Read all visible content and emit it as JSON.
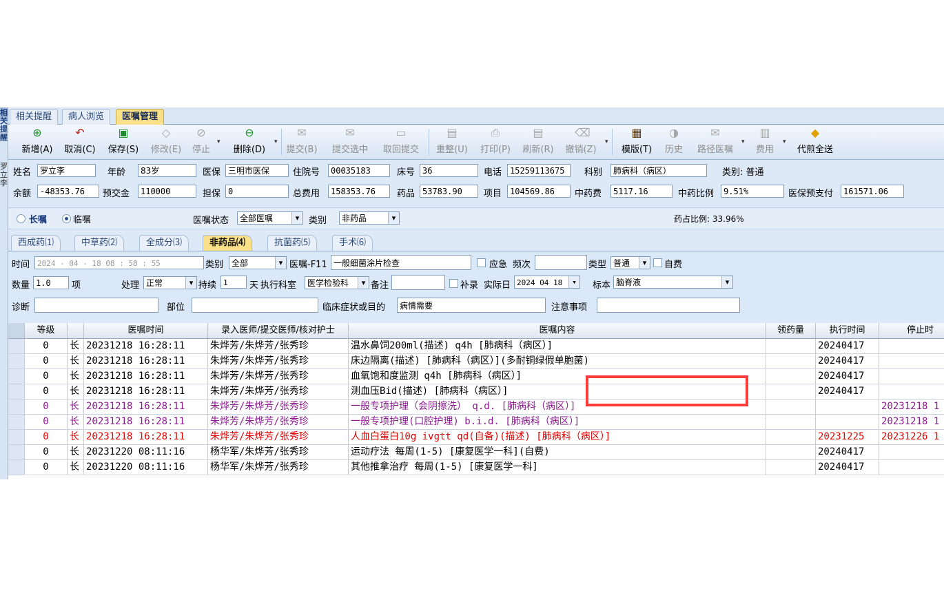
{
  "side": {
    "label1": "相关提醒",
    "label2": "罗立李"
  },
  "top_tabs": [
    "相关提醒",
    "病人浏览",
    "医嘱管理"
  ],
  "toolbar": [
    {
      "label": "新增(A)",
      "icon": "⊕"
    },
    {
      "label": "取消(C)",
      "icon": "↶"
    },
    {
      "label": "保存(S)",
      "icon": "▣"
    },
    {
      "label": "修改(E)",
      "icon": "◇"
    },
    {
      "label": "停止",
      "icon": "⊘"
    },
    {
      "label": "删除(D)",
      "icon": "⊖"
    },
    {
      "label": "提交(B)",
      "icon": "✉"
    },
    {
      "label": "提交选中",
      "icon": "✉"
    },
    {
      "label": "取回提交",
      "icon": "▭"
    },
    {
      "label": "重整(U)",
      "icon": "▤"
    },
    {
      "label": "打印(P)",
      "icon": "⎙"
    },
    {
      "label": "刷新(R)",
      "icon": "▤"
    },
    {
      "label": "撤销(Z)",
      "icon": "⌫"
    },
    {
      "label": "模版(T)",
      "icon": "▦"
    },
    {
      "label": "历史",
      "icon": "◑"
    },
    {
      "label": "路径医嘱",
      "icon": "✉"
    },
    {
      "label": "费用",
      "icon": "▥"
    },
    {
      "label": "代煎全送",
      "icon": "◆"
    }
  ],
  "patient": {
    "name_label": "姓名",
    "name": "罗立李",
    "age_label": "年龄",
    "age": "83岁",
    "insurance_label": "医保",
    "insurance": "三明市医保",
    "admission_label": "住院号",
    "admission": "00035183",
    "bed_label": "床号",
    "bed": "36",
    "phone_label": "电话",
    "phone": "15259113675",
    "dept_label": "科别",
    "dept": "肺病科（病区）",
    "category_text": "类别: 普通",
    "balance_label": "余额",
    "balance": "-48353.76",
    "prepay_label": "预交金",
    "prepay": "110000",
    "guarantee_label": "担保",
    "guarantee": "0",
    "total_label": "总费用",
    "total": "158353.76",
    "drug_label": "药品",
    "drug": "53783.90",
    "item_label": "项目",
    "item": "104569.86",
    "tcm_label": "中药费",
    "tcm": "5117.16",
    "tcm_ratio_label": "中药比例",
    "tcm_ratio": "9.51%",
    "ins_prepay_label": "医保预支付",
    "ins_prepay": "161571.06"
  },
  "order_filter": {
    "long_label": "长嘱",
    "temp_label": "临嘱",
    "status_label": "医嘱状态",
    "status": "全部医嘱",
    "type_label": "类别",
    "type": "非药品",
    "ratio_text": "药占比例: 33.96%"
  },
  "sub_tabs": [
    "西成药⑴",
    "中草药⑵",
    "全成分⑶",
    "非药品⑷",
    "抗菌药⑸",
    "手术⑹"
  ],
  "form": {
    "time_label": "时间",
    "time": "2024 - 04 - 18   08 : 58 : 55",
    "cat_label": "类别",
    "cat": "全部",
    "order_label": "医嘱-F11",
    "order": "一般细菌涂片检查",
    "urgent_label": "应急",
    "freq_label": "频次",
    "freq": "",
    "kind_label": "类型",
    "kind": "普通",
    "selfpay_label": "自费",
    "qty_label": "数量",
    "qty": "1.0",
    "unit": "项",
    "proc_label": "处理",
    "proc": "正常",
    "dur_label": "持续",
    "dur": "1",
    "day_label": "天",
    "exec_dept_label": "执行科室",
    "exec_dept": "医学检验科",
    "note_label": "备注",
    "note": "",
    "supp_label": "补录",
    "actual_label": "实际日",
    "actual": "2024 04 18",
    "specimen_label": "标本",
    "specimen": "脑脊液",
    "diag_label": "诊断",
    "diag": "",
    "site_label": "部位",
    "site": "",
    "purpose_label": "临床症状或目的",
    "purpose": "病情需要",
    "attention_label": "注意事项",
    "attention": ""
  },
  "grid": {
    "headers": [
      "等级",
      "",
      "医嘱时间",
      "录入医师/提交医师/核对护士",
      "医嘱内容",
      "领药量",
      "执行时间",
      "停止时"
    ],
    "rows": [
      {
        "level": "0",
        "type": "长",
        "time": "20231218 16:28:11",
        "doctors": "朱烨芳/朱烨芳/张秀珍",
        "content": "温水鼻饲200ml(描述)  q4h  [肺病科（病区）]",
        "qty": "",
        "exec": "20240417",
        "stop": "",
        "style": "normal"
      },
      {
        "level": "0",
        "type": "长",
        "time": "20231218 16:28:11",
        "doctors": "朱烨芳/朱烨芳/张秀珍",
        "content": "床边隔离(描述)     [肺病科（病区）](多耐铜绿假单胞菌)",
        "qty": "",
        "exec": "20240417",
        "stop": "",
        "style": "normal"
      },
      {
        "level": "0",
        "type": "长",
        "time": "20231218 16:28:11",
        "doctors": "朱烨芳/朱烨芳/张秀珍",
        "content": "血氧饱和度监测  q4h  [肺病科（病区）]",
        "qty": "",
        "exec": "20240417",
        "stop": "",
        "style": "normal"
      },
      {
        "level": "0",
        "type": "长",
        "time": "20231218 16:28:11",
        "doctors": "朱烨芳/朱烨芳/张秀珍",
        "content": "测血压Bid(描述)     [肺病科（病区）]",
        "qty": "",
        "exec": "20240417",
        "stop": "",
        "style": "normal"
      },
      {
        "level": "0",
        "type": "长",
        "time": "20231218 16:28:11",
        "doctors": "朱烨芳/朱烨芳/张秀珍",
        "content": "一般专项护理（会阴擦洗）  q.d.  [肺病科（病区）]",
        "qty": "",
        "exec": "",
        "stop": "20231218 1",
        "style": "purple"
      },
      {
        "level": "0",
        "type": "长",
        "time": "20231218 16:28:11",
        "doctors": "朱烨芳/朱烨芳/张秀珍",
        "content": "一般专项护理(口腔护理)  b.i.d.  [肺病科（病区）]",
        "qty": "",
        "exec": "",
        "stop": "20231218 1",
        "style": "purple"
      },
      {
        "level": "0",
        "type": "长",
        "time": "20231218 16:28:11",
        "doctors": "朱烨芳/朱烨芳/张秀珍",
        "content": "人血白蛋白10g ivgtt qd(自备)(描述)     [肺病科（病区）]",
        "qty": "",
        "exec": "20231225",
        "stop": "20231226 1",
        "style": "red"
      },
      {
        "level": "0",
        "type": "长",
        "time": "20231220 08:11:16",
        "doctors": "杨华军/朱烨芳/张秀珍",
        "content": "运动疗法  每周(1-5)  [康复医学一科](自费)",
        "qty": "",
        "exec": "20240417",
        "stop": "",
        "style": "normal"
      },
      {
        "level": "0",
        "type": "长",
        "time": "20231220 08:11:16",
        "doctors": "杨华军/朱烨芳/张秀珍",
        "content": "其他推拿治疗  每周(1-5)  [康复医学一科]",
        "qty": "",
        "exec": "20240417",
        "stop": "",
        "style": "normal"
      }
    ]
  },
  "colors": {
    "highlight": "#ff3b3b",
    "active_tab": "#fbe08a",
    "purple": "#8a1a8e",
    "red": "#e00000"
  }
}
